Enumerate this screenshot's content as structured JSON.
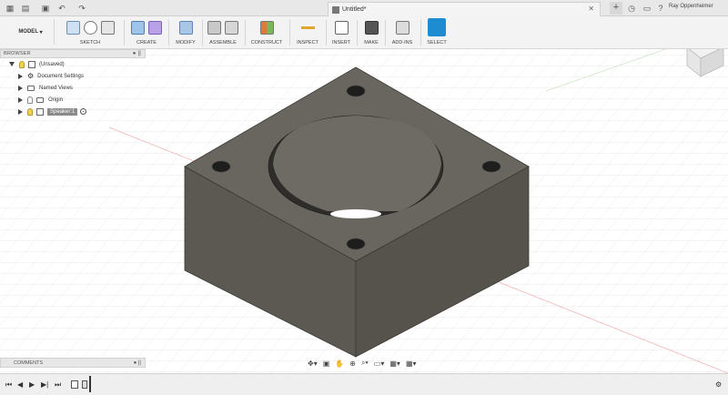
{
  "titlebar": {
    "doc_title": "Untitled*",
    "user": "Ray Oppenheimer"
  },
  "toolbar": {
    "workspace": "MODEL",
    "groups": [
      "SKETCH",
      "CREATE",
      "MODIFY",
      "ASSEMBLE",
      "CONSTRUCT",
      "INSPECT",
      "INSERT",
      "MAKE",
      "ADD-INS",
      "SELECT"
    ]
  },
  "browser": {
    "title": "BROWSER",
    "root": "(Unsaved)",
    "items": [
      "Document Settings",
      "Named Views",
      "Origin",
      "Speaker:1"
    ]
  },
  "comments": {
    "title": "COMMENTS"
  },
  "colors": {
    "select_active": "#1e8cd0",
    "body": "#5b5952",
    "top_face": "#68665f"
  }
}
